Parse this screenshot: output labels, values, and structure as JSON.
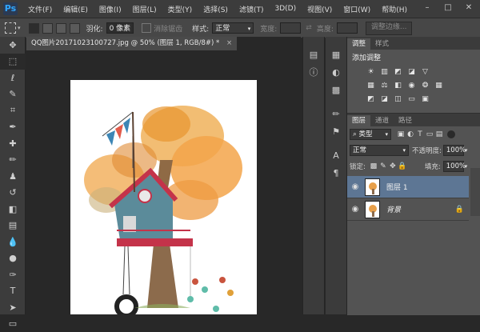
{
  "app": {
    "logo": "Ps"
  },
  "menu": [
    "文件(F)",
    "编辑(E)",
    "图像(I)",
    "图层(L)",
    "类型(Y)",
    "选择(S)",
    "滤镜(T)",
    "3D(D)",
    "视图(V)",
    "窗口(W)",
    "帮助(H)"
  ],
  "window_controls": [
    "–",
    "□",
    "✕"
  ],
  "options": {
    "feather_label": "羽化:",
    "feather_value": "0 像素",
    "antialias_label": "消除锯齿",
    "style_label": "样式:",
    "style_value": "正常",
    "width_label": "宽度:",
    "height_label": "高度:",
    "refine_edge": "调整边缘..."
  },
  "document": {
    "tab_title": "QQ图片20171023100727.jpg @ 50% (图层 1, RGB/8#) *",
    "close": "×"
  },
  "tools": [
    "move-icon",
    "marquee-icon",
    "lasso-icon",
    "quick-select-icon",
    "crop-icon",
    "eyedropper-icon",
    "healing-icon",
    "brush-icon",
    "stamp-icon",
    "history-brush-icon",
    "eraser-icon",
    "gradient-icon",
    "blur-icon",
    "dodge-icon",
    "pen-icon",
    "type-icon",
    "path-select-icon",
    "shape-icon"
  ],
  "panels": {
    "adjust_tabs": [
      "调整",
      "样式"
    ],
    "adjust_title": "添加调整",
    "layer_tabs": [
      "图层",
      "通道",
      "路径"
    ],
    "kind_label": "类型",
    "blend_mode": "正常",
    "opacity_label": "不透明度:",
    "opacity_value": "100%",
    "lock_label": "锁定:",
    "fill_label": "填充:",
    "fill_value": "100%",
    "layers": [
      {
        "name": "图层 1",
        "selected": true
      },
      {
        "name": "背景",
        "selected": false,
        "locked": true
      }
    ]
  },
  "colors": {
    "selected_layer": "#5d7694",
    "panel_bg": "#535353",
    "canvas_bg": "#282828"
  }
}
